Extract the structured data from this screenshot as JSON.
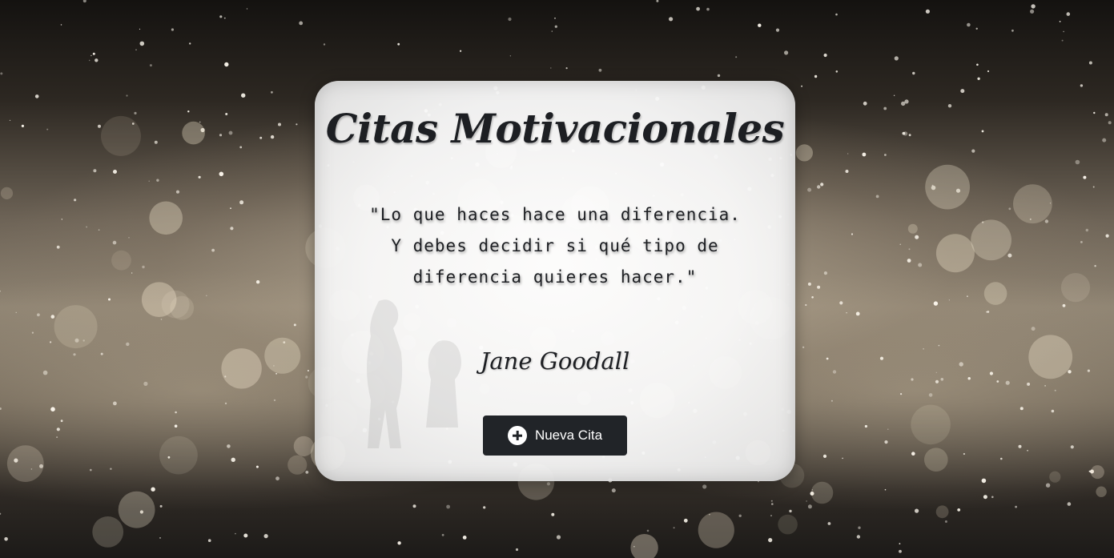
{
  "page": {
    "background_icon": "bokeh-sparkles-background"
  },
  "card": {
    "title": "Citas Motivacionales",
    "quote": "\"Lo que haces hace una diferencia. Y debes decidir si qué tipo de diferencia quieres hacer.\"",
    "author": "Jane Goodall",
    "new_quote_button": {
      "label": "Nueva Cita",
      "icon": "plus-circle-icon"
    }
  },
  "colors": {
    "button_bg": "#212428",
    "text": "#1d1f23",
    "card_bg": "#f7f7f7"
  }
}
